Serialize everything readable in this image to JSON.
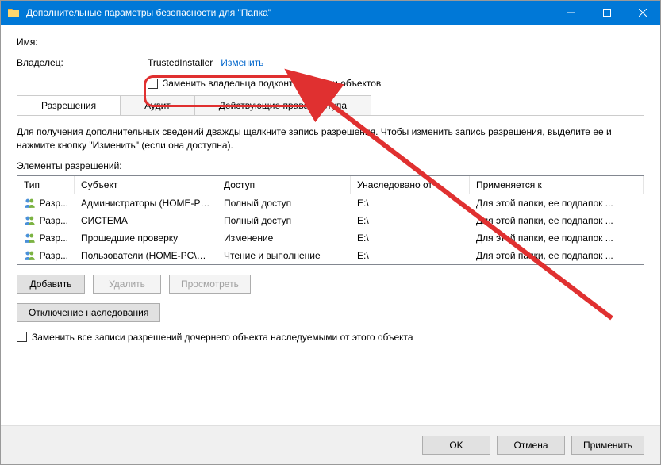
{
  "titlebar": {
    "title": "Дополнительные параметры безопасности для \"Папка\""
  },
  "fields": {
    "name_label": "Имя:",
    "name_value": "",
    "owner_label": "Владелец:",
    "owner_value": "TrustedInstaller",
    "owner_change": "Изменить"
  },
  "replace_owner_checkbox": "Заменить владельца подконтейнеров и объектов",
  "tabs": {
    "permissions": "Разрешения",
    "audit": "Аудит",
    "effective": "Действующие права доступа"
  },
  "instructions": "Для получения дополнительных сведений дважды щелкните запись разрешения. Чтобы изменить запись разрешения, выделите ее и нажмите кнопку \"Изменить\" (если она доступна).",
  "elements_label": "Элементы разрешений:",
  "table": {
    "headers": {
      "type": "Тип",
      "subject": "Субъект",
      "access": "Доступ",
      "inherited": "Унаследовано от",
      "applies": "Применяется к"
    },
    "rows": [
      {
        "type": "Разр...",
        "subject": "Администраторы (HOME-PC...",
        "access": "Полный доступ",
        "inherited": "E:\\",
        "applies": "Для этой папки, ее подпапок ..."
      },
      {
        "type": "Разр...",
        "subject": "СИСТЕМА",
        "access": "Полный доступ",
        "inherited": "E:\\",
        "applies": "Для этой папки, ее подпапок ..."
      },
      {
        "type": "Разр...",
        "subject": "Прошедшие проверку",
        "access": "Изменение",
        "inherited": "E:\\",
        "applies": "Для этой папки, ее подпапок ..."
      },
      {
        "type": "Разр...",
        "subject": "Пользователи (HOME-PC\\П...",
        "access": "Чтение и выполнение",
        "inherited": "E:\\",
        "applies": "Для этой папки, ее подпапок ..."
      }
    ]
  },
  "buttons": {
    "add": "Добавить",
    "remove": "Удалить",
    "view": "Просмотреть",
    "disable_inherit": "Отключение наследования"
  },
  "replace_child_checkbox": "Заменить все записи разрешений дочернего объекта наследуемыми от этого объекта",
  "bottom": {
    "ok": "OK",
    "cancel": "Отмена",
    "apply": "Применить"
  }
}
